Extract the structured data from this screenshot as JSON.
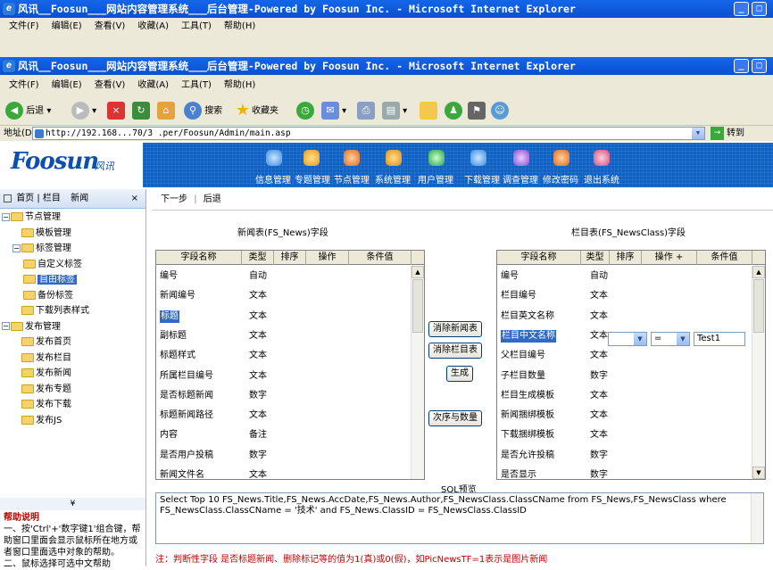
{
  "window_back": {
    "title": "风讯__Foosun___网站内容管理系统___后台管理-Powered by Foosun Inc. - Microsoft Internet Explorer",
    "menu": [
      "文件(F)",
      "编辑(E)",
      "查看(V)",
      "收藏(A)",
      "工具(T)",
      "帮助(H)"
    ]
  },
  "window": {
    "title": "风讯__Foosun___网站内容管理系统___后台管理-Powered by Foosun Inc. - Microsoft Internet Explorer",
    "menu": [
      "文件(F)",
      "编辑(E)",
      "查看(V)",
      "收藏(A)",
      "工具(T)",
      "帮助(H)"
    ]
  },
  "toolbar": {
    "back": "后退",
    "search": "搜索",
    "favorites": "收藏夹"
  },
  "address": {
    "label": "地址(D)",
    "url": "http://192.168...70/3 .per/Foosun/Admin/main.asp",
    "go": "转到"
  },
  "banner": {
    "logo": "Foosun",
    "logo_sub": "风讯",
    "nav": [
      "信息管理",
      "专题管理",
      "节点管理",
      "系统管理",
      "用户管理",
      "下载管理",
      "调查管理",
      "修改密码",
      "退出系统"
    ]
  },
  "left_panel": {
    "tabs": [
      "首页",
      "栏目",
      "新闻"
    ],
    "close": "×",
    "tree": [
      {
        "label": "节点管理",
        "level": 0
      },
      {
        "label": "模板管理",
        "level": 1
      },
      {
        "label": "标签管理",
        "level": 1
      },
      {
        "label": "自定义标签",
        "level": 2
      },
      {
        "label": "自由标签",
        "level": 2,
        "selected": true
      },
      {
        "label": "备份标签",
        "level": 2
      },
      {
        "label": "下载列表样式",
        "level": 1
      },
      {
        "label": "发布管理",
        "level": 0
      },
      {
        "label": "发布首页",
        "level": 1
      },
      {
        "label": "发布栏目",
        "level": 1
      },
      {
        "label": "发布新闻",
        "level": 1
      },
      {
        "label": "发布专题",
        "level": 1
      },
      {
        "label": "发布下载",
        "level": 1
      },
      {
        "label": "发布JS",
        "level": 1
      }
    ],
    "help_toggle": "¥",
    "help_title": "帮助说明",
    "help_text_1": "一、按'Ctrl'+'数字键1'组合键，帮助窗口里面会显示鼠标所在地方或者窗口里面选中对象的帮助。",
    "help_text_2": "二、鼠标选择可选中文帮助"
  },
  "main": {
    "tabs": [
      "下一步",
      "后退"
    ],
    "left_title": "新闻表(FS_News)字段",
    "right_title": "栏目表(FS_NewsClass)字段",
    "left_headers": [
      "字段名称",
      "类型",
      "排序",
      "操作",
      "条件值"
    ],
    "right_headers": [
      "字段名称",
      "类型",
      "排序",
      "操作 +",
      "条件值"
    ],
    "left_rows": [
      {
        "name": "编号",
        "type": "自动"
      },
      {
        "name": "新闻编号",
        "type": "文本"
      },
      {
        "name": "标题",
        "type": "文本",
        "selected": true
      },
      {
        "name": "副标题",
        "type": "文本"
      },
      {
        "name": "标题样式",
        "type": "文本"
      },
      {
        "name": "所属栏目编号",
        "type": "文本"
      },
      {
        "name": "是否标题新闻",
        "type": "数字"
      },
      {
        "name": "标题新闻路径",
        "type": "文本"
      },
      {
        "name": "内容",
        "type": "备注"
      },
      {
        "name": "是否用户投稿",
        "type": "数字"
      },
      {
        "name": "新闻文件名",
        "type": "文本"
      }
    ],
    "right_rows": [
      {
        "name": "编号",
        "type": "自动"
      },
      {
        "name": "栏目编号",
        "type": "文本"
      },
      {
        "name": "栏目英文名称",
        "type": "文本"
      },
      {
        "name": "栏目中文名称",
        "type": "文本",
        "selected": true
      },
      {
        "name": "父栏目编号",
        "type": "文本"
      },
      {
        "name": "子栏目数量",
        "type": "数字"
      },
      {
        "name": "栏目生成模板",
        "type": "文本"
      },
      {
        "name": "新闻捆绑模板",
        "type": "文本"
      },
      {
        "name": "下载捆绑模板",
        "type": "文本"
      },
      {
        "name": "是否允许投稿",
        "type": "数字"
      },
      {
        "name": "是否显示",
        "type": "数字"
      }
    ],
    "condition_op": "=",
    "condition_value": "Test1",
    "buttons": {
      "remove_news": "消除新闻表",
      "remove_class": "消除栏目表",
      "generate": "生成",
      "count": "次序与数量"
    },
    "sql_title": "SQL预览",
    "sql": "Select Top 10 FS_News.Title,FS_News.AccDate,FS_News.Author,FS_NewsClass.ClassCName from FS_News,FS_NewsClass where FS_NewsClass.ClassCName = '技术' and FS_News.ClassID = FS_NewsClass.ClassID",
    "note": "注：判断性字段 是否标题新闻、删除标记等的值为1(真)或0(假)，如PicNewsTF=1表示是图片新闻"
  }
}
